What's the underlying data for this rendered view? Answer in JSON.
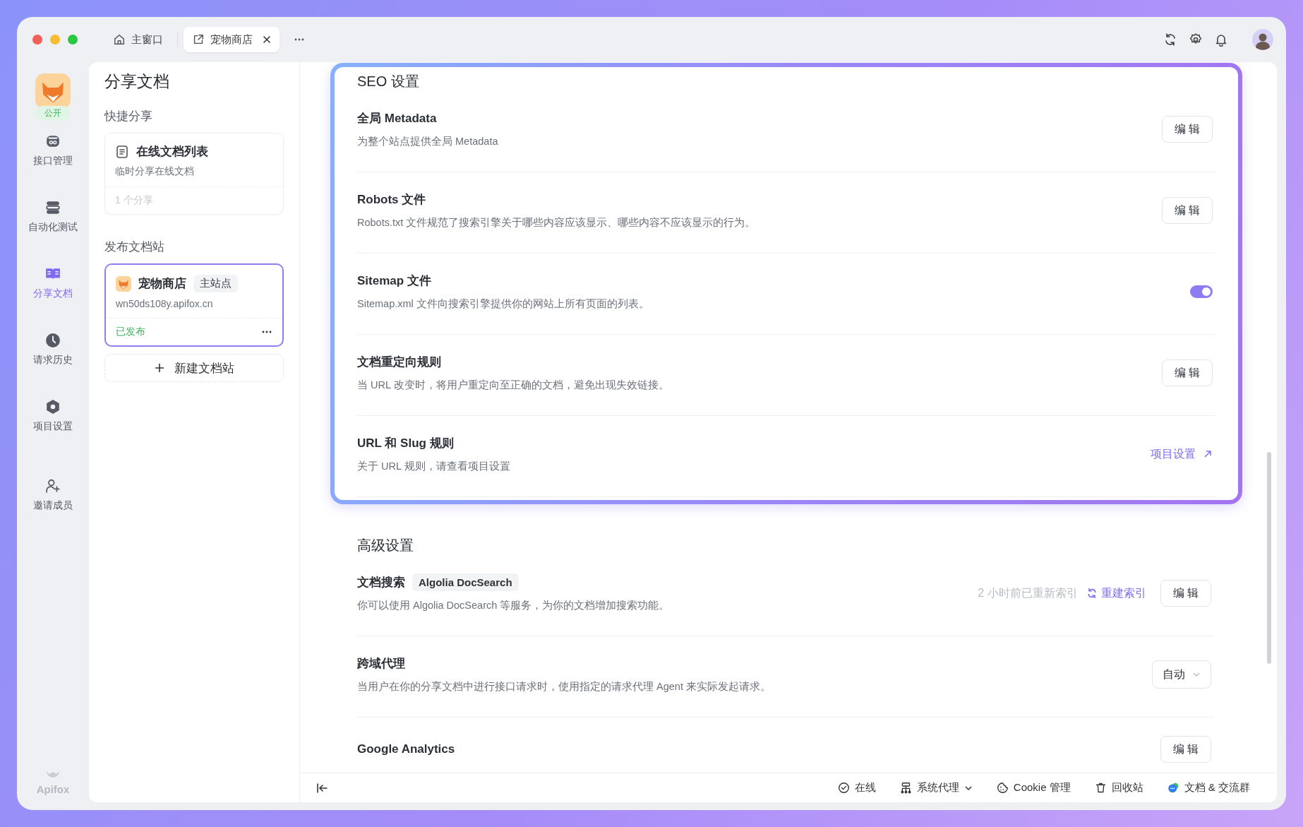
{
  "window": {
    "tabs": [
      {
        "label": "主窗口",
        "selected": false
      },
      {
        "label": "宠物商店",
        "selected": true
      }
    ]
  },
  "nav": {
    "badge": "公开",
    "items": [
      {
        "label": "接口管理",
        "selected": false
      },
      {
        "label": "自动化测试",
        "selected": false
      },
      {
        "label": "分享文档",
        "selected": true
      },
      {
        "label": "请求历史",
        "selected": false
      },
      {
        "label": "项目设置",
        "selected": false
      },
      {
        "label": "邀请成员",
        "selected": false
      }
    ],
    "brand": "Apifox"
  },
  "panel": {
    "title": "分享文档",
    "sections": [
      {
        "title": "快捷分享",
        "cards": [
          {
            "kind": "list",
            "title": "在线文档列表",
            "subtitle": "临时分享在线文档",
            "footer": "1 个分享",
            "selected": false
          }
        ]
      },
      {
        "title": "发布文档站",
        "cards": [
          {
            "kind": "site",
            "title": "宠物商店",
            "tag": "主站点",
            "subtitle": "wn50ds108y.apifox.cn",
            "footer": "已发布",
            "selected": true
          }
        ],
        "add_button": "新建文档站"
      }
    ]
  },
  "sections": [
    {
      "title": "SEO 设置",
      "rows": [
        {
          "title": "全局 Metadata",
          "description": "为整个站点提供全局 Metadata",
          "control": {
            "kind": "button",
            "label": "编 辑"
          }
        },
        {
          "title": "Robots 文件",
          "description": "Robots.txt 文件规范了搜索引擎关于哪些内容应该显示、哪些内容不应该显示的行为。",
          "control": {
            "kind": "button",
            "label": "编 辑"
          }
        },
        {
          "title": "Sitemap 文件",
          "description": "Sitemap.xml 文件向搜索引擎提供你的网站上所有页面的列表。",
          "control": {
            "kind": "toggle",
            "on": true
          }
        },
        {
          "title": "文档重定向规则",
          "description": "当 URL 改变时，将用户重定向至正确的文档，避免出现失效链接。",
          "control": {
            "kind": "button",
            "label": "编 辑"
          }
        },
        {
          "title": "URL 和 Slug 规则",
          "description": "关于 URL 规则，请查看项目设置",
          "control": {
            "kind": "link",
            "label": "项目设置"
          }
        }
      ]
    },
    {
      "title": "高级设置",
      "rows": [
        {
          "title": "文档搜索",
          "tag": "Algolia DocSearch",
          "description": "你可以使用 Algolia DocSearch 等服务，为你的文档增加搜索功能。",
          "status": "2 小时前已重新索引",
          "action": "重建索引",
          "control": {
            "kind": "button",
            "label": "编 辑"
          }
        },
        {
          "title": "跨域代理",
          "description": "当用户在你的分享文档中进行接口请求时，使用指定的请求代理 Agent 来实际发起请求。",
          "control": {
            "kind": "select",
            "value": "自动"
          }
        },
        {
          "title": "Google Analytics",
          "control": {
            "kind": "button",
            "label": "编 辑"
          }
        }
      ]
    }
  ],
  "status_bar": [
    {
      "label": "在线"
    },
    {
      "label": "系统代理"
    },
    {
      "label": "Cookie 管理"
    },
    {
      "label": "回收站"
    },
    {
      "label": "文档 & 交流群"
    }
  ]
}
